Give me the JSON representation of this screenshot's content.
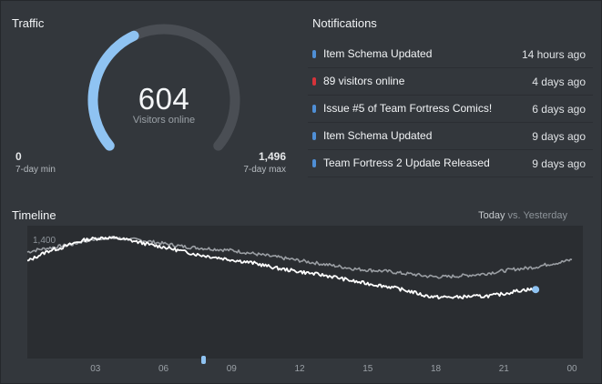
{
  "traffic": {
    "title": "Traffic",
    "visitors_value": "604",
    "visitors_label": "Visitors online",
    "min_value": "0",
    "min_label": "7-day min",
    "max_value": "1,496",
    "max_label": "7-day max",
    "gauge_fraction": 0.404,
    "track_color": "#4a4e54",
    "fill_color": "#8fc3f2"
  },
  "notifications": {
    "title": "Notifications",
    "items": [
      {
        "text": "Item Schema Updated",
        "time": "14 hours ago",
        "color": "#4f8fd6"
      },
      {
        "text": "89 visitors online",
        "time": "4 days ago",
        "color": "#d6333a"
      },
      {
        "text": "Issue #5 of Team Fortress Comics!",
        "time": "6 days ago",
        "color": "#4f8fd6"
      },
      {
        "text": "Item Schema Updated",
        "time": "9 days ago",
        "color": "#4f8fd6"
      },
      {
        "text": "Team Fortress 2 Update Released",
        "time": "9 days ago",
        "color": "#4f8fd6"
      }
    ]
  },
  "timeline": {
    "title": "Timeline",
    "legend_today": "Today",
    "legend_vs": "vs.",
    "legend_yesterday": "Yesterday",
    "y_tick_label": "1,400",
    "x_tick_labels": [
      "03",
      "06",
      "09",
      "12",
      "15",
      "18",
      "21",
      "00"
    ],
    "today_color": "#ffffff",
    "yesterday_color": "#9a9ea3",
    "marker_color": "#8fc3f2"
  },
  "chart_data": {
    "type": "line",
    "xlabel": "",
    "ylabel": "",
    "xlim": [
      0,
      24
    ],
    "ylim": [
      0,
      1560
    ],
    "y_ticks": [
      1400
    ],
    "x_ticks": [
      3,
      6,
      9,
      12,
      15,
      18,
      21,
      24
    ],
    "x_tick_labels": [
      "03",
      "06",
      "09",
      "12",
      "15",
      "18",
      "21",
      "00"
    ],
    "series": [
      {
        "name": "Today",
        "x": [
          0,
          0.5,
          1,
          1.5,
          2,
          2.5,
          3,
          3.5,
          4,
          4.5,
          5,
          5.5,
          6,
          6.5,
          7,
          7.5,
          8,
          8.5,
          9,
          9.5,
          10,
          10.5,
          11,
          11.5,
          12,
          12.5,
          13,
          13.5,
          14,
          14.5,
          15,
          15.5,
          16,
          16.5,
          17,
          17.5,
          18,
          18.5,
          19,
          19.5,
          20,
          20.5,
          21,
          21.5,
          22,
          22.4
        ],
        "y": [
          1140,
          1210,
          1270,
          1300,
          1350,
          1390,
          1410,
          1420,
          1410,
          1390,
          1360,
          1330,
          1310,
          1280,
          1250,
          1220,
          1200,
          1180,
          1160,
          1140,
          1120,
          1090,
          1060,
          1040,
          1020,
          1000,
          980,
          960,
          930,
          900,
          880,
          860,
          840,
          810,
          780,
          740,
          720,
          720,
          720,
          730,
          730,
          740,
          760,
          790,
          810,
          810
        ]
      },
      {
        "name": "Yesterday",
        "x": [
          0,
          0.5,
          1,
          1.5,
          2,
          2.5,
          3,
          3.5,
          4,
          4.5,
          5,
          5.5,
          6,
          6.5,
          7,
          7.5,
          8,
          8.5,
          9,
          9.5,
          10,
          10.5,
          11,
          11.5,
          12,
          12.5,
          13,
          13.5,
          14,
          14.5,
          15,
          15.5,
          16,
          16.5,
          17,
          17.5,
          18,
          18.5,
          19,
          19.5,
          20,
          20.5,
          21,
          21.5,
          22,
          22.5,
          23,
          23.5,
          24
        ],
        "y": [
          1250,
          1280,
          1300,
          1320,
          1340,
          1380,
          1400,
          1420,
          1410,
          1400,
          1390,
          1370,
          1350,
          1330,
          1310,
          1300,
          1290,
          1280,
          1270,
          1250,
          1230,
          1210,
          1190,
          1170,
          1150,
          1130,
          1110,
          1090,
          1070,
          1050,
          1040,
          1030,
          1020,
          1000,
          990,
          970,
          960,
          960,
          970,
          980,
          990,
          1010,
          1030,
          1050,
          1060,
          1080,
          1110,
          1130,
          1160
        ]
      }
    ],
    "marker_points": [
      {
        "series": "Today",
        "x": 22.4,
        "y": 810
      }
    ]
  }
}
